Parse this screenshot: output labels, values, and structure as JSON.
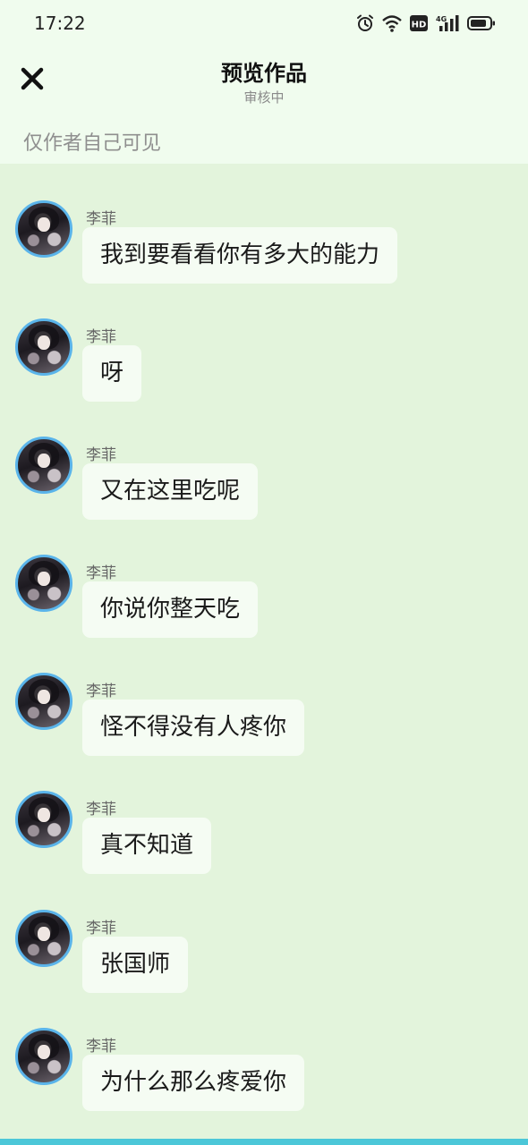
{
  "status_bar": {
    "time": "17:22",
    "icons": [
      "alarm-icon",
      "wifi-icon",
      "hd-icon",
      "4g-signal-icon",
      "battery-icon"
    ],
    "hd_label": "HD",
    "network_label": "4G"
  },
  "header": {
    "title": "预览作品",
    "status": "审核中",
    "visibility_note": "仅作者自己可见",
    "close_icon": "close-icon"
  },
  "messages": [
    {
      "sender": "李菲",
      "text": "我到要看看你有多大的能力"
    },
    {
      "sender": "李菲",
      "text": "呀"
    },
    {
      "sender": "李菲",
      "text": "又在这里吃呢"
    },
    {
      "sender": "李菲",
      "text": "你说你整天吃"
    },
    {
      "sender": "李菲",
      "text": "怪不得没有人疼你"
    },
    {
      "sender": "李菲",
      "text": "真不知道"
    },
    {
      "sender": "李菲",
      "text": "张国师"
    },
    {
      "sender": "李菲",
      "text": "为什么那么疼爱你"
    }
  ],
  "colors": {
    "background": "#e3f4dc",
    "header_background": "#f0fcee",
    "bubble": "#f5fcf3",
    "avatar_ring": "#5ab4ea",
    "bottom_bar": "#4cc7d8"
  }
}
